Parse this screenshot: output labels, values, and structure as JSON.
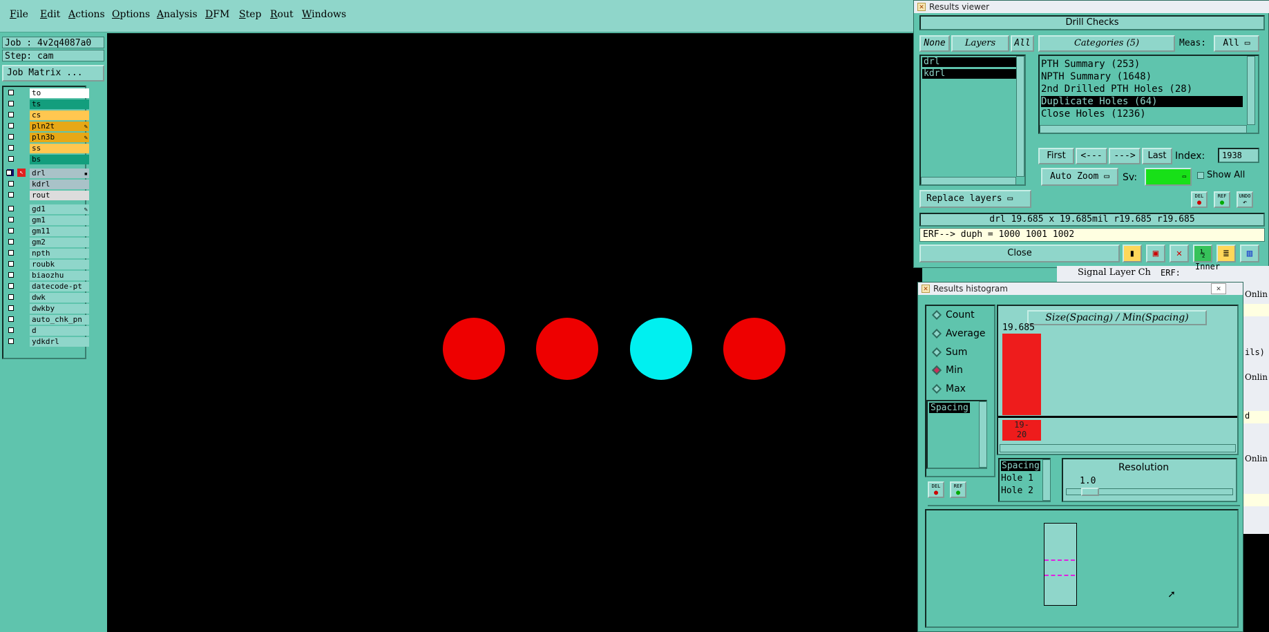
{
  "menu": [
    "File",
    "Edit",
    "Actions",
    "Options",
    "Analysis",
    "DFM",
    "Step",
    "Rout",
    "Windows"
  ],
  "left": {
    "job": "Job : 4v2q4087a0",
    "step": "Step: cam",
    "job_matrix": "Job Matrix ...",
    "layers": [
      {
        "name": "to",
        "color": "#ffffff",
        "mark": ""
      },
      {
        "name": "ts",
        "color": "#139e7d",
        "mark": ""
      },
      {
        "name": "cs",
        "color": "#ffc750",
        "mark": ""
      },
      {
        "name": "pln2t",
        "color": "#e6a817",
        "mark": "✎"
      },
      {
        "name": "pln3b",
        "color": "#e6a817",
        "mark": "✎"
      },
      {
        "name": "ss",
        "color": "#ffc750",
        "mark": ""
      },
      {
        "name": "bs",
        "color": "#139e7d",
        "mark": ""
      },
      {
        "name": "drl",
        "color": "#a9c2c8",
        "mark": "▪"
      },
      {
        "name": "kdrl",
        "color": "#a9c2c8",
        "mark": ""
      },
      {
        "name": "rout",
        "color": "#dcdcdc",
        "mark": ""
      },
      {
        "name": "gd1",
        "color": "#8fd6ca",
        "mark": "✎"
      },
      {
        "name": "gm1",
        "color": "#8fd6ca",
        "mark": ""
      },
      {
        "name": "gm11",
        "color": "#8fd6ca",
        "mark": ""
      },
      {
        "name": "gm2",
        "color": "#8fd6ca",
        "mark": ""
      },
      {
        "name": "npth",
        "color": "#8fd6ca",
        "mark": ""
      },
      {
        "name": "roubk",
        "color": "#8fd6ca",
        "mark": ""
      },
      {
        "name": "biaozhu",
        "color": "#8fd6ca",
        "mark": ""
      },
      {
        "name": "datecode-pt",
        "color": "#8fd6ca",
        "mark": ""
      },
      {
        "name": "dwk",
        "color": "#8fd6ca",
        "mark": ""
      },
      {
        "name": "dwkby",
        "color": "#8fd6ca",
        "mark": ""
      },
      {
        "name": "auto_chk_pn",
        "color": "#8fd6ca",
        "mark": ""
      },
      {
        "name": "d",
        "color": "#8fd6ca",
        "mark": ""
      },
      {
        "name": "ydkdrl",
        "color": "#8fd6ca",
        "mark": ""
      }
    ]
  },
  "canvas": {
    "holes": [
      {
        "color": "#ee0000"
      },
      {
        "color": "#ee0000"
      },
      {
        "color": "#00f0f0"
      },
      {
        "color": "#ee0000"
      }
    ]
  },
  "results_viewer": {
    "title": "Results viewer",
    "header": "Drill Checks",
    "none": "None",
    "layers": "Layers",
    "all": "All",
    "layer_items": [
      "drl",
      "kdrl"
    ],
    "categories_label": "Categories (5)",
    "meas_label": "Meas:",
    "meas_value": "All",
    "categories": [
      "PTH Summary (253)",
      "NPTH Summary (1648)",
      "2nd Drilled PTH Holes (28)",
      "Duplicate Holes (64)",
      "Close Holes (1236)"
    ],
    "first": "First",
    "prev": "<---",
    "next": "--->",
    "last": "Last",
    "index_label": "Index:",
    "index_value": "1938",
    "auto_zoom": "Auto Zoom",
    "sv_label": "Sv:",
    "show_all": "Show All",
    "replace_layers": "Replace layers",
    "info_line": "drl 19.685 x 19.685mil  r19.685  r19.685",
    "erf_line": "ERF--> duph = 1000 1001 1002",
    "close": "Close",
    "del": "DEL",
    "ref": "REF",
    "undo": "UNDO"
  },
  "histogram": {
    "title": "Results histogram",
    "modes": [
      "Count",
      "Average",
      "Sum",
      "Min",
      "Max"
    ],
    "selected_mode": "Min",
    "chart_title": "Size(Spacing) / Min(Spacing)",
    "bar_value": "19.685",
    "bar_range": "19-\n20",
    "field_list": [
      "Spacing"
    ],
    "sub_list": [
      "Spacing",
      "Hole 1",
      "Hole 2"
    ],
    "resolution_label": "Resolution",
    "resolution_value": "1.0",
    "del": "DEL",
    "ref": "REF"
  },
  "background_fragments": {
    "signal": "Signal Layer Ch",
    "erf": "ERF:",
    "inner": "Inner",
    "onlin1": "Onlin",
    "ils": "ils)",
    "onlin2": "Onlin",
    "d": "d",
    "onlin3": "Onlin"
  }
}
